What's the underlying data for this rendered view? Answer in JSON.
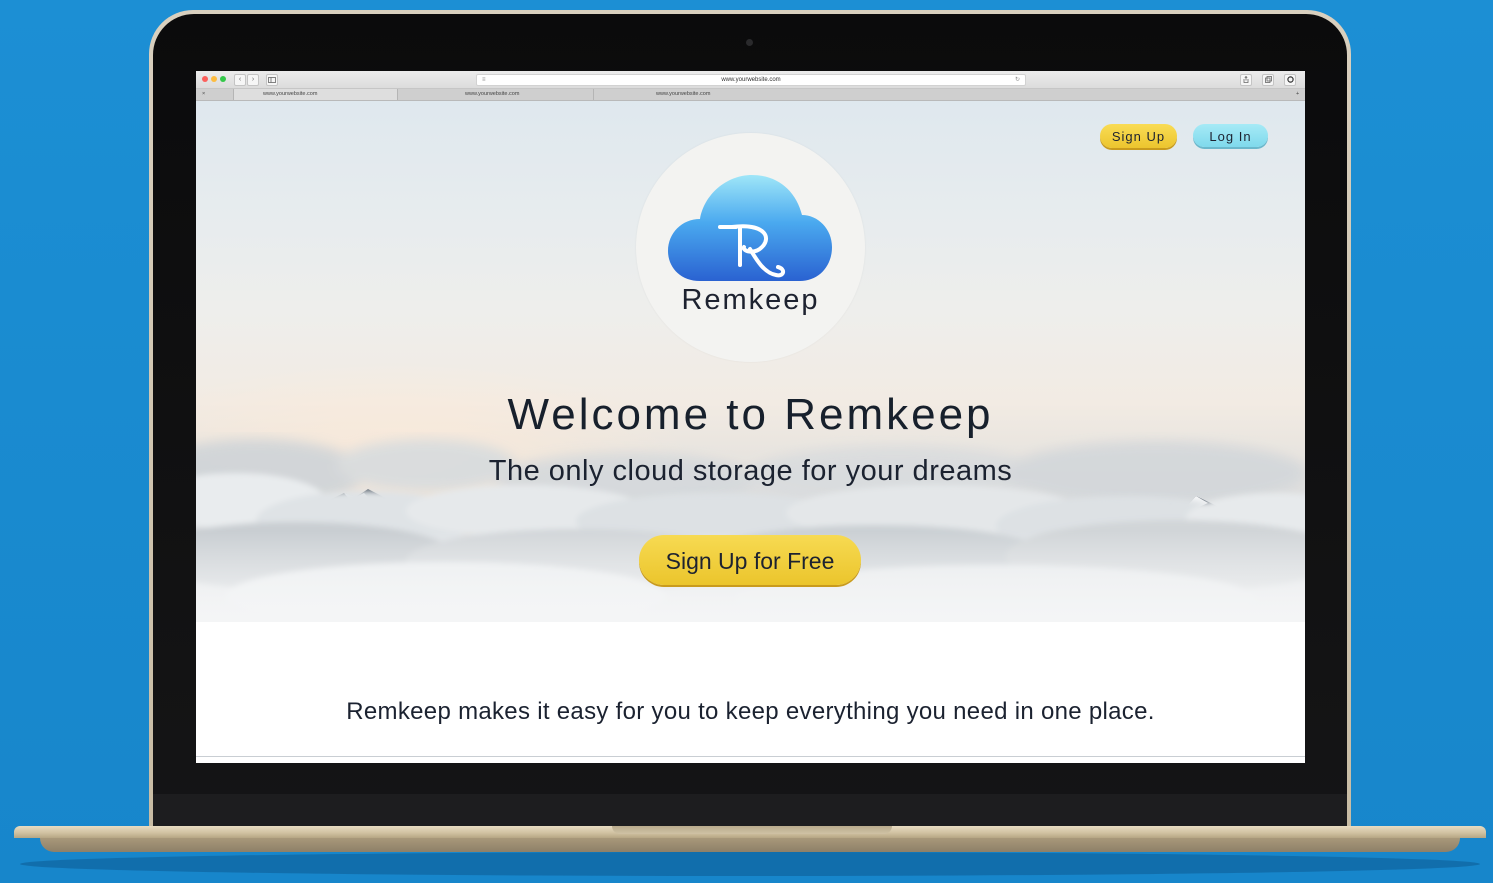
{
  "browser": {
    "url": "www.yourwebsite.com",
    "tabs": [
      {
        "label": "www.yourwebsite.com"
      },
      {
        "label": "www.yourwebsite.com"
      },
      {
        "label": "www.yourwebsite.com"
      }
    ],
    "tab_close_glyph": "×",
    "new_tab_glyph": "+",
    "back_glyph": "‹",
    "forward_glyph": "›",
    "reload_glyph": "↻"
  },
  "header": {
    "signup_label": "Sign Up",
    "login_label": "Log In"
  },
  "logo": {
    "wordmark": "Remkeep",
    "icon": "cloud-r-icon"
  },
  "hero": {
    "title": "Welcome to Remkeep",
    "subtitle": "The only cloud storage for your dreams",
    "cta_label": "Sign Up for Free"
  },
  "body": {
    "tagline": "Remkeep makes it easy for you to keep everything you need in one place."
  },
  "colors": {
    "background": "#1a8bd0",
    "signup_button": "#f2cf40",
    "login_button": "#8fe0f1",
    "cloud_logo": "#3a8fe8",
    "text": "#1b2230"
  }
}
